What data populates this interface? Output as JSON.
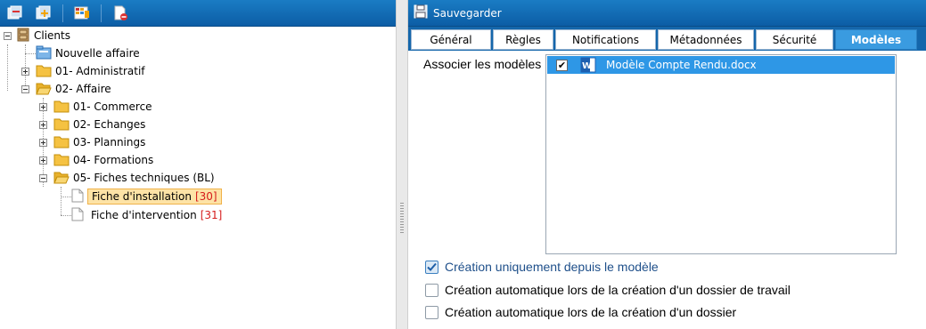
{
  "toolbar": {
    "buttons": [
      "collapse-all-icon",
      "add-folder-icon",
      "grid-config-icon",
      "remove-document-icon"
    ]
  },
  "tree": {
    "root": "Clients",
    "items": [
      {
        "label": "Nouvelle affaire"
      },
      {
        "label": "01- Administratif"
      },
      {
        "label": "02- Affaire"
      },
      {
        "label": "01- Commerce"
      },
      {
        "label": "02- Echanges"
      },
      {
        "label": "03- Plannings"
      },
      {
        "label": "04- Formations"
      },
      {
        "label": "05- Fiches techniques (BL)"
      },
      {
        "label": "Fiche d'installation",
        "count": "[30]"
      },
      {
        "label": "Fiche d'intervention",
        "count": "[31]"
      }
    ]
  },
  "right_toolbar": {
    "save_label": "Sauvegarder"
  },
  "tabs": [
    {
      "label": "Général"
    },
    {
      "label": "Règles"
    },
    {
      "label": "Notifications"
    },
    {
      "label": "Métadonnées"
    },
    {
      "label": "Sécurité"
    },
    {
      "label": "Modèles",
      "active": true
    }
  ],
  "models": {
    "label": "Associer les modèles",
    "items": [
      {
        "name": "Modèle Compte Rendu.docx",
        "checked": true
      }
    ]
  },
  "options": [
    {
      "label": "Création uniquement depuis le modèle",
      "checked": true
    },
    {
      "label": "Création automatique lors de la création d'un dossier de travail",
      "checked": false
    },
    {
      "label": "Création automatique lors de la création d'un dossier",
      "checked": false
    }
  ],
  "colors": {
    "header_blue": "#0c5da5",
    "tab_active": "#3a9be0",
    "selection": "#2e97e6",
    "highlight": "#fde3a6",
    "count_red": "#d51b1b"
  }
}
